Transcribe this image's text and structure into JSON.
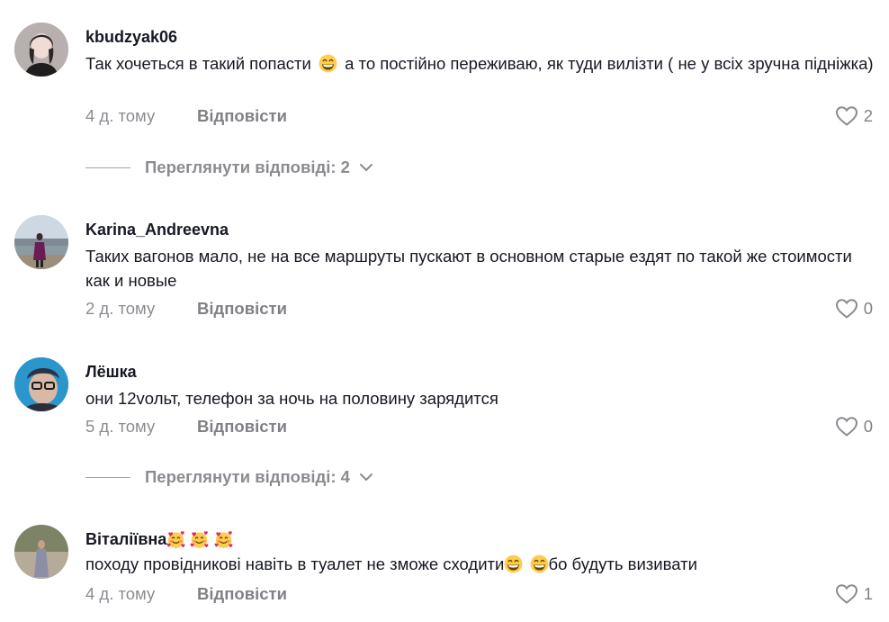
{
  "comments": [
    {
      "username": "kbudzyak06",
      "text_a": "Так хочеться в такий попасти",
      "text_b": "а то постійно переживаю, як туди вилізти ( не у всіх зручна підніжка)",
      "time": "4 д. тому",
      "reply_label": "Відповісти",
      "likes": "2",
      "emojis": [
        "grinning-face"
      ]
    },
    {
      "username": "Karina_Andreevna",
      "text": "Таких вагонов мало, не на все маршруты пускают в основном старые ездят по такой же стоимости как и новые",
      "time": "2 д. тому",
      "reply_label": "Відповісти",
      "likes": "0"
    },
    {
      "username": "Лёшка",
      "text": "они 12vольт, телефон за ночь на половину зарядится",
      "time": "5 д. тому",
      "reply_label": "Відповісти",
      "likes": "0"
    },
    {
      "username": "Віталіївна",
      "username_emojis": [
        "smiling-face-with-hearts",
        "smiling-face-with-hearts",
        "smiling-face-with-hearts"
      ],
      "text_a": "походу провідникові навіть в туалет не зможе сходити",
      "text_b": "бо будуть визивати",
      "time": "4 д. тому",
      "reply_label": "Відповісти",
      "likes": "1",
      "emojis": [
        "grinning-face",
        "grinning-face"
      ]
    }
  ],
  "view_replies": [
    {
      "label": "Переглянути відповіді: 2"
    },
    {
      "label": "Переглянути відповіді: 4"
    }
  ],
  "icons": {
    "like": "heart-outline-icon",
    "expand": "chevron-down-icon"
  },
  "colors": {
    "text": "#161823",
    "secondary": "#8a8b91",
    "emoji_face": "#ffcc4d"
  }
}
